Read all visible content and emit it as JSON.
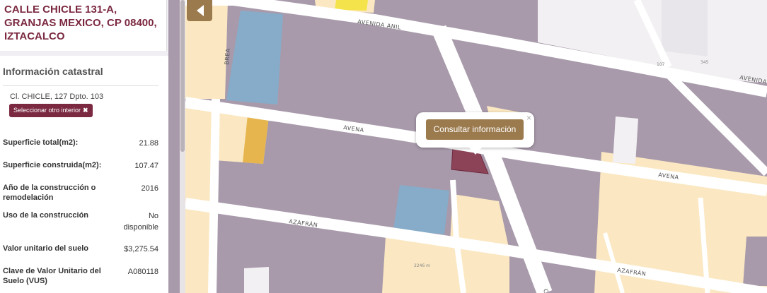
{
  "address": {
    "line1": "CALLE CHICLE 131-A,",
    "line2": "GRANJAS MEXICO, CP 08400,",
    "line3": "IZTACALCO"
  },
  "cadastral": {
    "title": "Información catastral",
    "subject": "Cl. CHICLE, 127 Dpto. 103",
    "select_button": "Seleccionar otro interior",
    "rows": [
      {
        "label": "Superficie total(m2):",
        "value": "21.88"
      },
      {
        "label": "Superficie construida(m2):",
        "value": "107.47"
      },
      {
        "label": "Año de la construcción o remodelación",
        "value": "2016"
      },
      {
        "label": "Uso de la construcción",
        "value": "No disponible"
      },
      {
        "label": "Valor unitario del suelo",
        "value": "$3,275.54"
      },
      {
        "label": "Clave de Valor Unitario del Suelo (VUS)",
        "value": "A080118"
      }
    ]
  },
  "popup": {
    "button": "Consultar información",
    "close": "×"
  },
  "map": {
    "streets": {
      "avenida_anil_top": "AVENIDA ANIL",
      "avenida_right_top": "AVENIDA",
      "brea": "BREA",
      "avena_left": "AVENA",
      "avena_right": "AVENA",
      "azafran_left": "AZAFRÁN",
      "azafran_right": "AZAFRÁN",
      "chicle": "CH"
    },
    "numbers": {
      "n345": "345",
      "n107": "107",
      "n2246": "2246 m"
    },
    "colors": {
      "block": "#a89aab",
      "residential": "#fbe8c2",
      "water": "#86acc9",
      "accent": "#e6b54e",
      "selected": "#8c4358",
      "road": "#ffffff",
      "panel_brand": "#7b2941",
      "button": "#9b7a4d"
    }
  }
}
